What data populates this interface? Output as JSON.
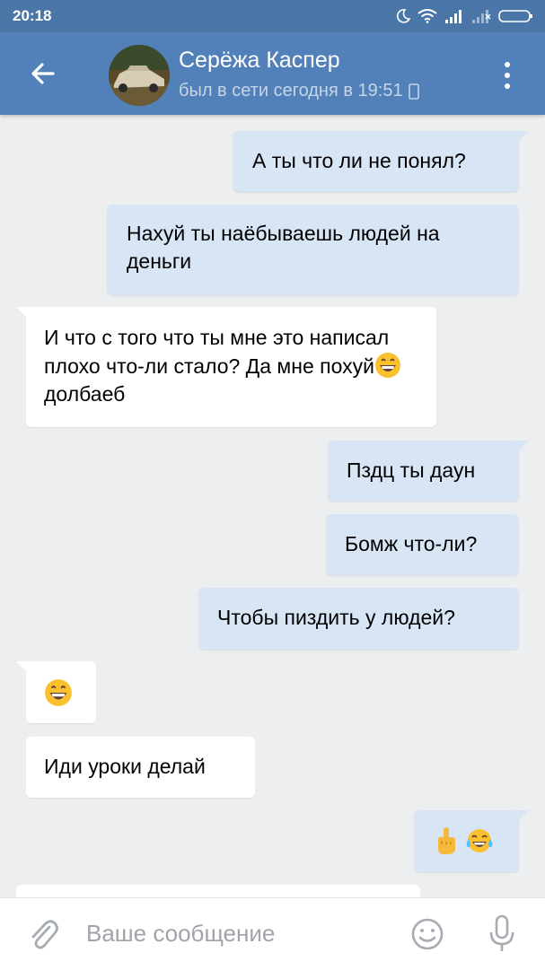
{
  "status_bar": {
    "time": "20:18"
  },
  "header": {
    "contact_name": "Серёжа Каспер",
    "last_seen": "был в сети сегодня в 19:51"
  },
  "messages": [
    {
      "side": "out",
      "text": "А ты что ли не понял?"
    },
    {
      "side": "out",
      "text": "Нахуй ты наёбываешь людей на деньги"
    },
    {
      "side": "in",
      "text_before": "И что с того что ты мне это написал плохо что-ли стало? Да мне похуй",
      "text_after": "долбаеб"
    },
    {
      "side": "out",
      "text": "Пздц ты даун"
    },
    {
      "side": "out",
      "text": "Бомж что-ли?"
    },
    {
      "side": "out",
      "text": "Чтобы пиздить у людей?"
    },
    {
      "side": "in",
      "emoji": "grinning-face"
    },
    {
      "side": "in",
      "text": "Иди уроки делай"
    },
    {
      "side": "out",
      "emoji": [
        "middle-finger",
        "tears-of-joy"
      ]
    }
  ],
  "composer": {
    "placeholder": "Ваше сообщение"
  },
  "icons": [
    "moon-icon",
    "wifi-icon",
    "signal-icon",
    "signal-icon",
    "battery-icon",
    "back-arrow-icon",
    "phone-icon",
    "more-vertical-icon",
    "paperclip-icon",
    "smile-icon",
    "microphone-icon"
  ],
  "colors": {
    "header": "#5181b8",
    "statusbar": "#4a76a8",
    "outgoing_bubble": "#d7e5f5",
    "incoming_bubble": "#ffffff",
    "background": "#edeef0"
  }
}
